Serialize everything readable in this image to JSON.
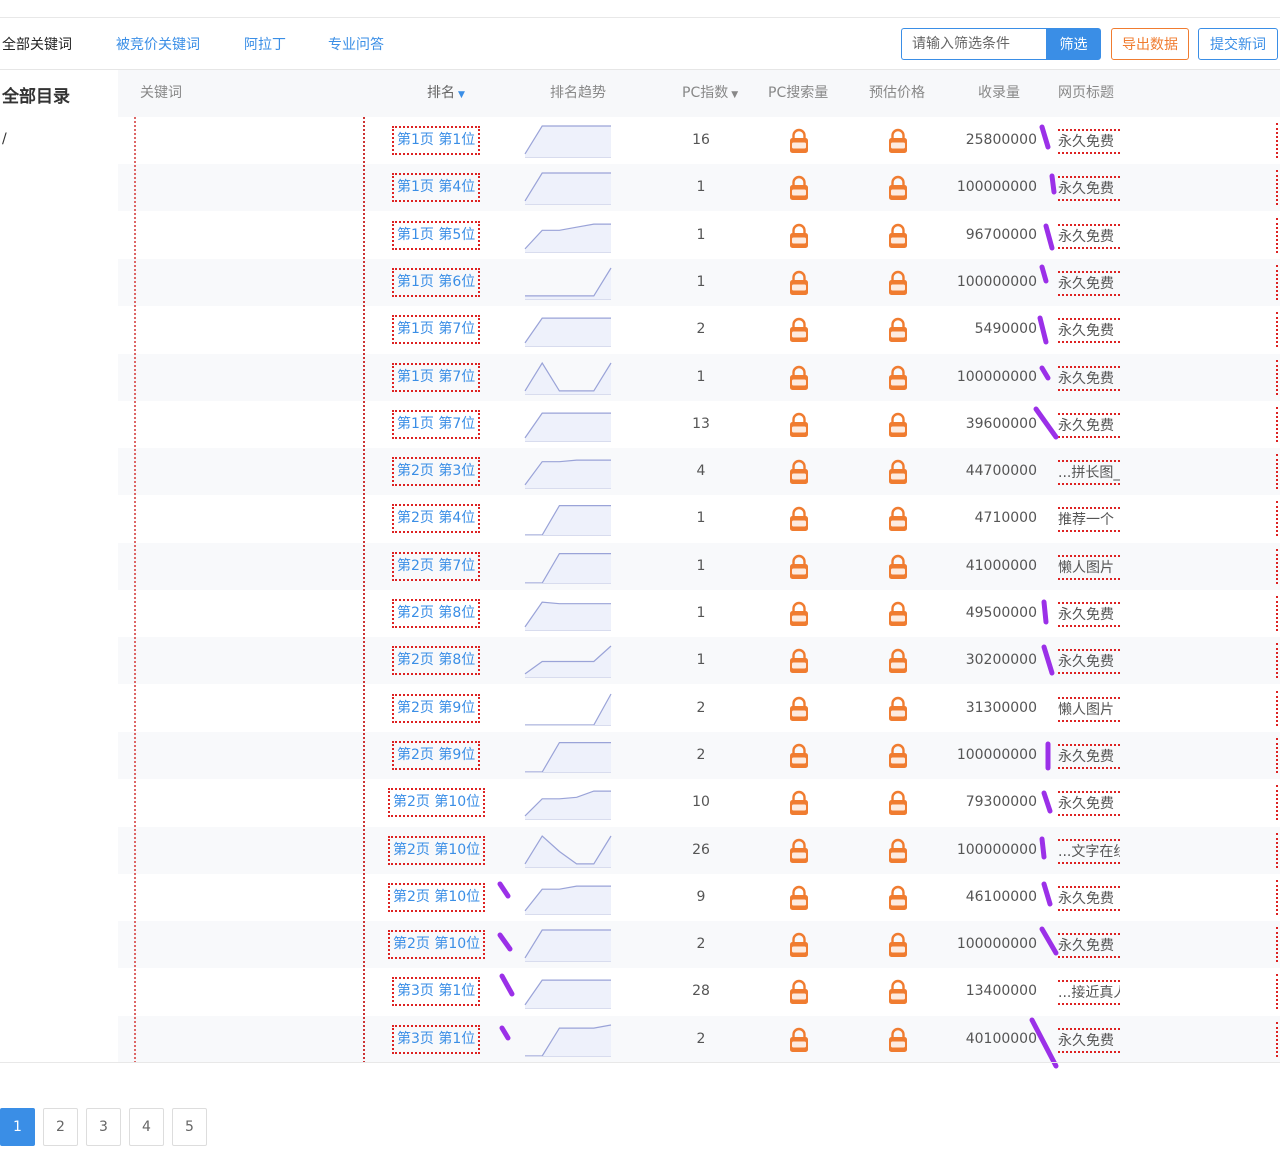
{
  "tabs": [
    {
      "label": "全部关键词",
      "active": true
    },
    {
      "label": "被竞价关键词",
      "active": false
    },
    {
      "label": "阿拉丁",
      "active": false
    },
    {
      "label": "专业问答",
      "active": false
    }
  ],
  "toolbar": {
    "filter_placeholder": "请输入筛选条件",
    "filter_label": "筛选",
    "export_label": "导出数据",
    "submit_label": "提交新词"
  },
  "sidebar": {
    "title": "全部目录",
    "items": [
      "/"
    ]
  },
  "table": {
    "columns": [
      "关键词",
      "排名",
      "排名趋势",
      "PC指数",
      "PC搜索量",
      "预估价格",
      "收录量",
      "网页标题"
    ],
    "sorted_column": "排名",
    "lock_icon": "vip-lock-icon",
    "rows": [
      {
        "rank": "第1页 第1位",
        "trend": [
          0.1,
          1,
          1,
          1,
          1,
          1
        ],
        "pc_index": "16",
        "indexed": "25800000",
        "title": "永久免费"
      },
      {
        "rank": "第1页 第4位",
        "trend": [
          0.1,
          1,
          1,
          1,
          1,
          1
        ],
        "pc_index": "1",
        "indexed": "100000000",
        "title": "永久免费"
      },
      {
        "rank": "第1页 第5位",
        "trend": [
          0.1,
          0.7,
          0.7,
          0.8,
          0.9,
          0.9
        ],
        "pc_index": "1",
        "indexed": "96700000",
        "title": "永久免费"
      },
      {
        "rank": "第1页 第6位",
        "trend": [
          0.1,
          0.1,
          0.1,
          0.1,
          0.1,
          1
        ],
        "pc_index": "1",
        "indexed": "100000000",
        "title": "永久免费"
      },
      {
        "rank": "第1页 第7位",
        "trend": [
          0.1,
          0.9,
          0.9,
          0.9,
          0.9,
          0.9
        ],
        "pc_index": "2",
        "indexed": "5490000",
        "title": "永久免费"
      },
      {
        "rank": "第1页 第7位",
        "trend": [
          0.1,
          1,
          0.1,
          0.1,
          0.1,
          1
        ],
        "pc_index": "1",
        "indexed": "100000000",
        "title": "永久免费"
      },
      {
        "rank": "第1页 第7位",
        "trend": [
          0.1,
          0.9,
          0.9,
          0.9,
          0.9,
          0.9
        ],
        "pc_index": "13",
        "indexed": "39600000",
        "title": "永久免费"
      },
      {
        "rank": "第2页 第3位",
        "trend": [
          0.1,
          0.85,
          0.85,
          0.9,
          0.9,
          0.9
        ],
        "pc_index": "4",
        "indexed": "44700000",
        "title": "...拼长图_"
      },
      {
        "rank": "第2页 第4位",
        "trend": [
          0.0,
          0.0,
          0.95,
          0.95,
          0.95,
          0.95
        ],
        "pc_index": "1",
        "indexed": "4710000",
        "title": "推荐一个"
      },
      {
        "rank": "第2页 第7位",
        "trend": [
          0.0,
          0.0,
          0.95,
          0.95,
          0.95,
          0.95
        ],
        "pc_index": "1",
        "indexed": "41000000",
        "title": "懒人图片"
      },
      {
        "rank": "第2页 第8位",
        "trend": [
          0.1,
          0.9,
          0.85,
          0.85,
          0.85,
          0.85
        ],
        "pc_index": "1",
        "indexed": "49500000",
        "title": "永久免费"
      },
      {
        "rank": "第2页 第8位",
        "trend": [
          0.1,
          0.5,
          0.5,
          0.5,
          0.5,
          1
        ],
        "pc_index": "1",
        "indexed": "30200000",
        "title": "永久免费"
      },
      {
        "rank": "第2页 第9位",
        "trend": [
          0.0,
          0.0,
          0.0,
          0.0,
          0.0,
          1
        ],
        "pc_index": "2",
        "indexed": "31300000",
        "title": "懒人图片"
      },
      {
        "rank": "第2页 第9位",
        "trend": [
          0.0,
          0.0,
          0.95,
          0.95,
          0.95,
          0.95
        ],
        "pc_index": "2",
        "indexed": "100000000",
        "title": "永久免费"
      },
      {
        "rank": "第2页 第10位",
        "trend": [
          0.1,
          0.65,
          0.65,
          0.7,
          0.9,
          0.9
        ],
        "pc_index": "10",
        "indexed": "79300000",
        "title": "永久免费"
      },
      {
        "rank": "第2页 第10位",
        "trend": [
          0.1,
          1,
          0.5,
          0.1,
          0.1,
          1
        ],
        "pc_index": "26",
        "indexed": "100000000",
        "title": "...文字在线"
      },
      {
        "rank": "第2页 第10位",
        "trend": [
          0.1,
          0.8,
          0.8,
          0.9,
          0.9,
          0.9
        ],
        "pc_index": "9",
        "indexed": "46100000",
        "title": "永久免费"
      },
      {
        "rank": "第2页 第10位",
        "trend": [
          0.1,
          1,
          1,
          1,
          1,
          1
        ],
        "pc_index": "2",
        "indexed": "100000000",
        "title": "永久免费"
      },
      {
        "rank": "第3页 第1位",
        "trend": [
          0.1,
          0.9,
          0.9,
          0.9,
          0.9,
          0.9
        ],
        "pc_index": "28",
        "indexed": "13400000",
        "title": "...接近真人"
      },
      {
        "rank": "第3页 第1位",
        "trend": [
          0.0,
          0.0,
          0.9,
          0.9,
          0.9,
          1
        ],
        "pc_index": "2",
        "indexed": "40100000",
        "title": "永久免费"
      }
    ]
  },
  "pagination": {
    "pages": [
      "1",
      "2",
      "3",
      "4",
      "5"
    ],
    "current": "1"
  },
  "colors": {
    "accent": "#3a8ee6",
    "export": "#f07c30",
    "lock": "#f07c30",
    "annotation": "#9b30e8",
    "dotted_box": "#dd2222"
  }
}
